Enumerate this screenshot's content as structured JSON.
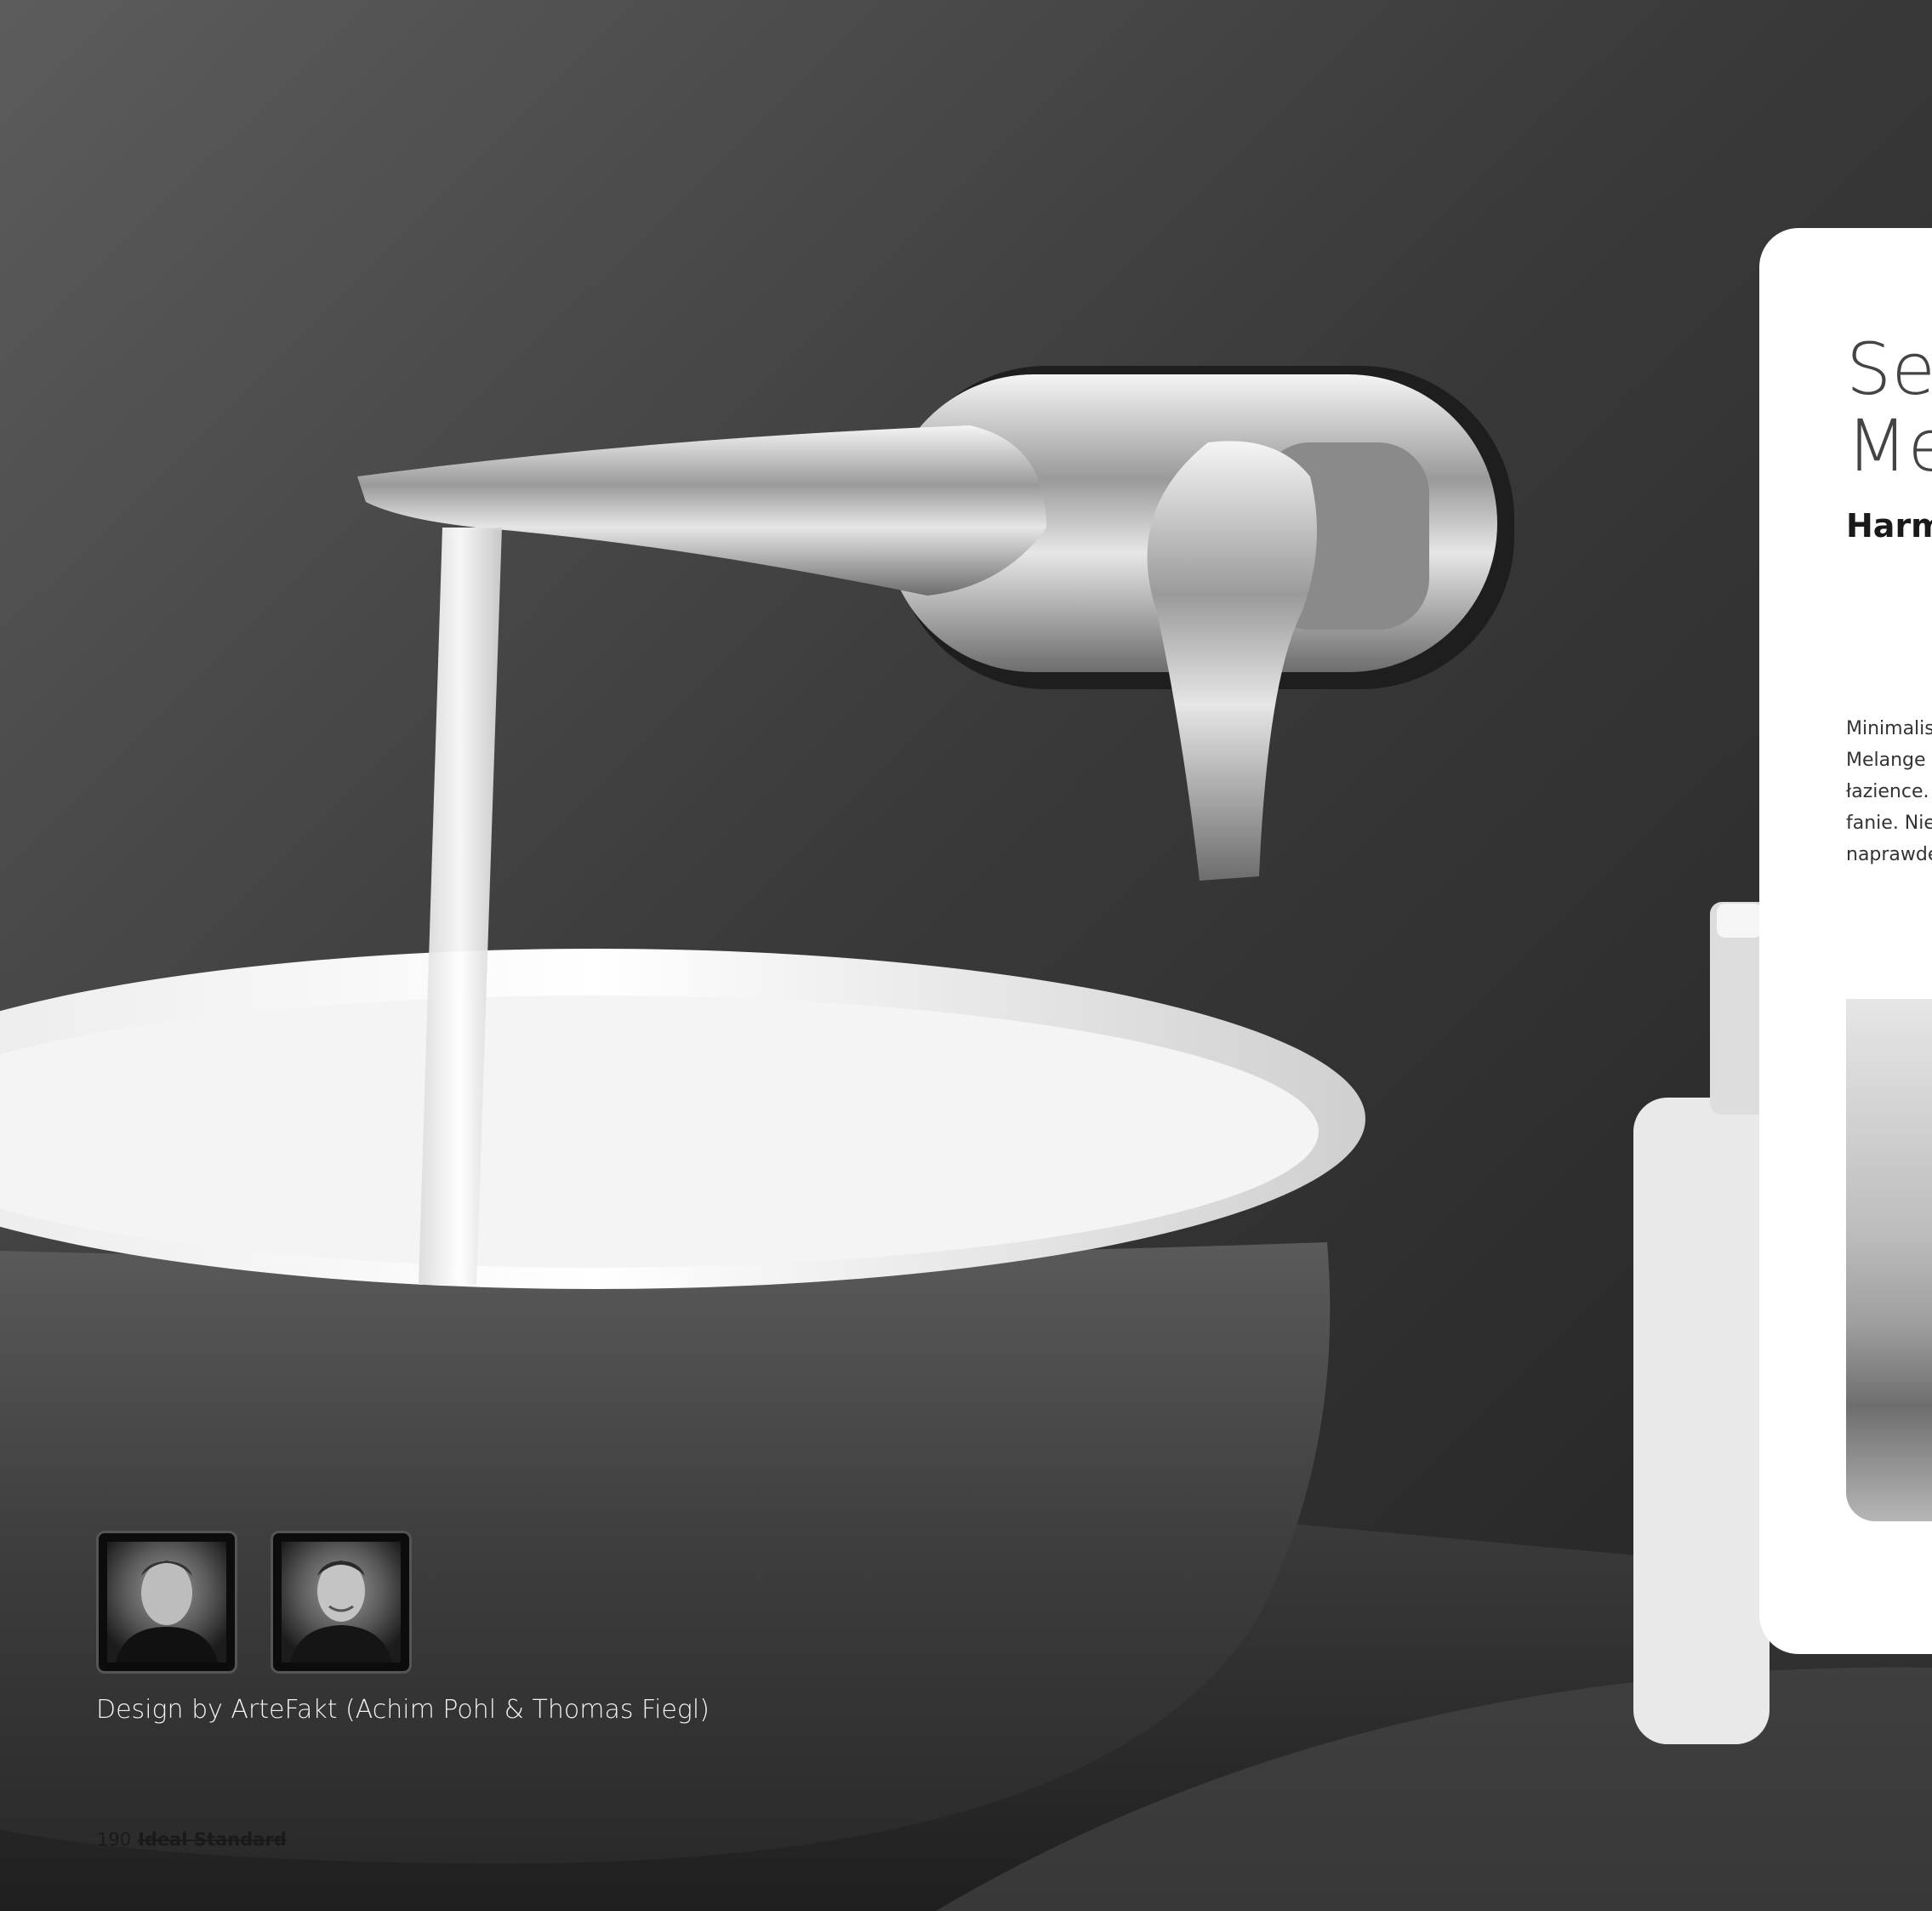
{
  "title": {
    "line1": "Se",
    "line2": "Me"
  },
  "subtitle": "Harm",
  "body_lines": [
    "Minimalis",
    "Melange",
    "łazience.",
    "fanie. Nie",
    "naprawdę"
  ],
  "designers": {
    "credit": "Design by ArteFakt (Achim Pohl & Thomas Fiegl)",
    "portraits": [
      {
        "person": "Achim Pohl"
      },
      {
        "person": "Thomas Fiegl"
      }
    ]
  },
  "footer": {
    "page_number": "190",
    "brand": "Ideal Standard"
  },
  "colors": {
    "wall": "#2f2f2f",
    "panel": "#ffffff",
    "basin": "#f2f2f2",
    "chrome": "#cfcfcf"
  }
}
